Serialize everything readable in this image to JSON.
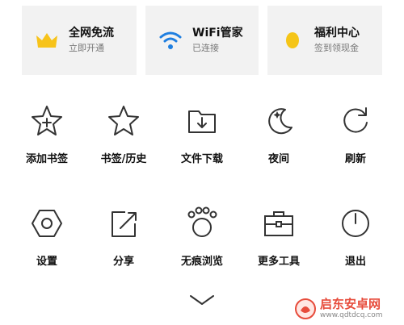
{
  "cards": [
    {
      "title": "全网免流",
      "subtitle": "立即开通",
      "icon": "crown-icon"
    },
    {
      "title": "WiFi管家",
      "subtitle": "已连接",
      "icon": "wifi-icon"
    },
    {
      "title": "福利中心",
      "subtitle": "签到领现金",
      "icon": "coin-icon"
    }
  ],
  "menu": [
    {
      "label": "添加书签",
      "icon": "star-plus-icon"
    },
    {
      "label": "书签/历史",
      "icon": "star-icon"
    },
    {
      "label": "文件下载",
      "icon": "folder-download-icon"
    },
    {
      "label": "夜间",
      "icon": "moon-icon"
    },
    {
      "label": "刷新",
      "icon": "refresh-icon"
    },
    {
      "label": "设置",
      "icon": "hexagon-settings-icon"
    },
    {
      "label": "分享",
      "icon": "share-icon"
    },
    {
      "label": "无痕浏览",
      "icon": "paw-icon"
    },
    {
      "label": "更多工具",
      "icon": "toolbox-icon"
    },
    {
      "label": "退出",
      "icon": "power-icon"
    }
  ],
  "watermark": {
    "title": "启东安卓网",
    "url": "www.qdtdcq.com"
  },
  "colors": {
    "crown": "#f7c31a",
    "wifi": "#1f7fe0",
    "coin": "#f5c518",
    "icon_stroke": "#333333",
    "watermark": "#e74c3c"
  }
}
